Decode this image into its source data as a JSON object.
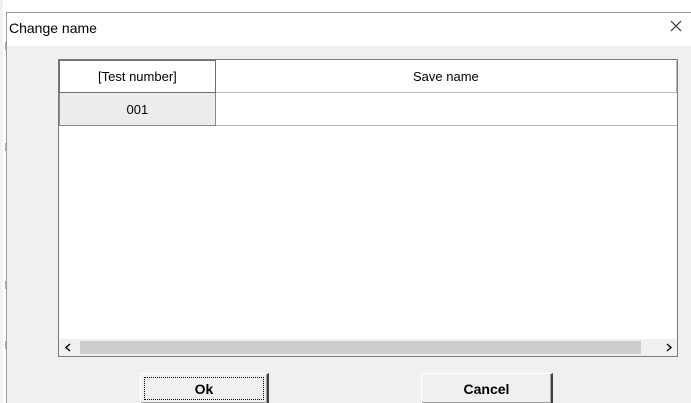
{
  "dialog": {
    "title": "Change name",
    "close_glyph": "×"
  },
  "grid": {
    "columns": [
      "[Test number]",
      "Save name"
    ],
    "rows": [
      {
        "test_number": "001",
        "save_name": ""
      }
    ],
    "scroll_left_glyph": "<",
    "scroll_right_glyph": ">"
  },
  "buttons": {
    "ok_label": "Ok",
    "cancel_label": "Cancel"
  },
  "icons": {
    "close": "close-icon",
    "scroll_left": "arrow-left-icon",
    "scroll_right": "arrow-right-icon"
  },
  "colors": {
    "dialog_bg": "#f0f0f0",
    "titlebar_bg": "#ffffff",
    "grid_bg": "#ffffff",
    "row_header_bg": "#ececec",
    "scroll_thumb": "#cdcdcd"
  }
}
